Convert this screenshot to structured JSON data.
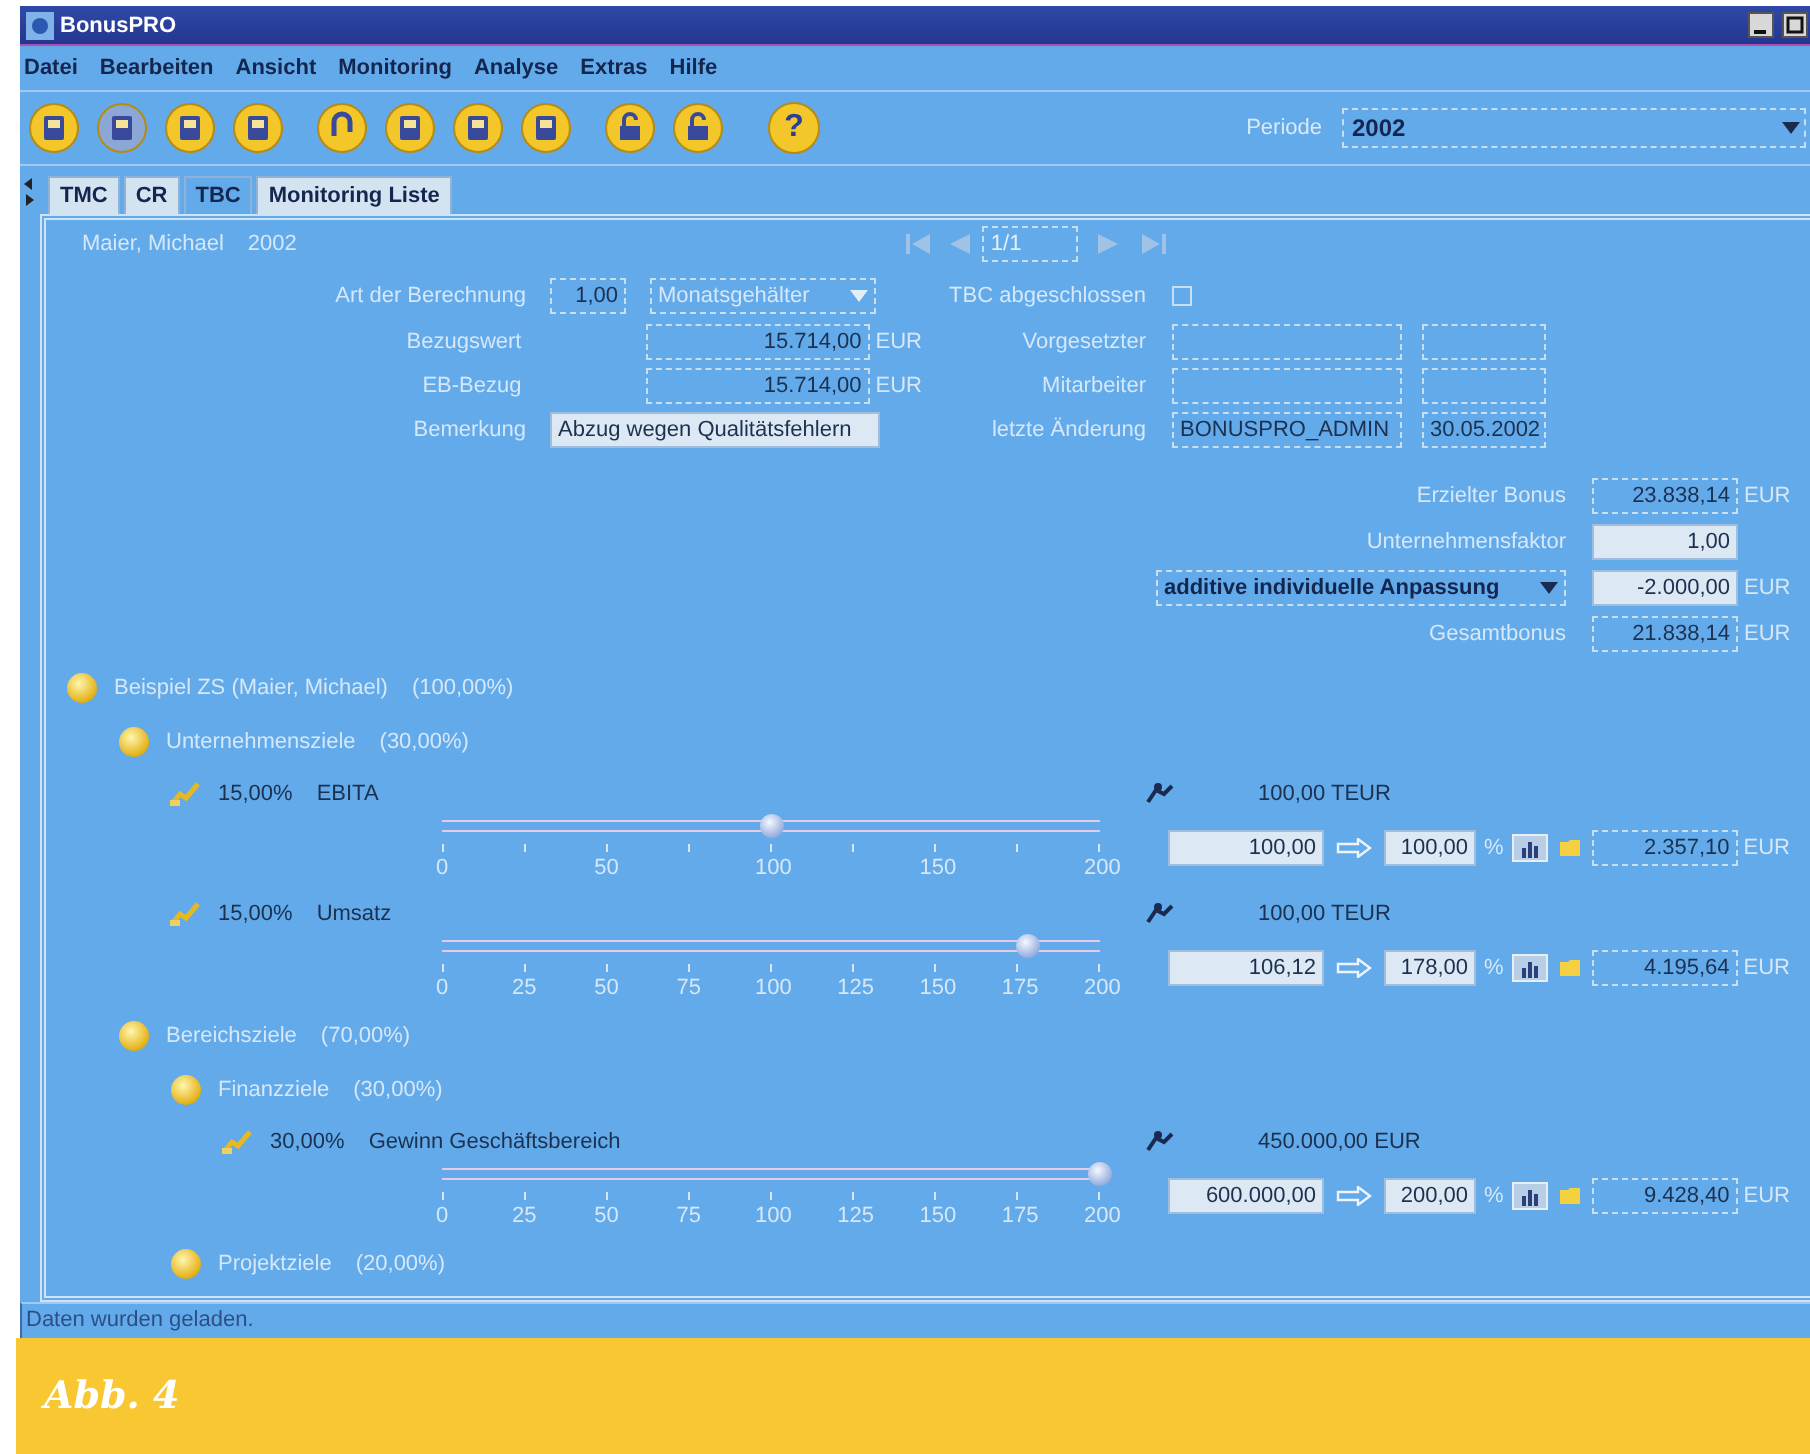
{
  "window": {
    "title": "BonusPRO"
  },
  "menu": [
    "Datei",
    "Bearbeiten",
    "Ansicht",
    "Monitoring",
    "Analyse",
    "Extras",
    "Hilfe"
  ],
  "toolbar": {
    "help_label": "?"
  },
  "period": {
    "label": "Periode",
    "value": "2002"
  },
  "tabs": [
    {
      "label": "TMC",
      "selected": false
    },
    {
      "label": "CR",
      "selected": false
    },
    {
      "label": "TBC",
      "selected": true
    },
    {
      "label": "Monitoring Liste",
      "selected": false
    }
  ],
  "header": {
    "name": "Maier, Michael",
    "year": "2002",
    "page": "1/1"
  },
  "form": {
    "calc": {
      "label": "Art der Berechnung",
      "factor": "1,00",
      "type": "Monatsgehälter"
    },
    "reference": {
      "label": "Bezugswert",
      "value": "15.714,00",
      "unit": "EUR"
    },
    "eb": {
      "label": "EB-Bezug",
      "value": "15.714,00",
      "unit": "EUR"
    },
    "remark": {
      "label": "Bemerkung",
      "value": "Abzug wegen Qualitätsfehlern"
    },
    "closed": {
      "label": "TBC abgeschlossen",
      "checked": false
    },
    "superior": {
      "label": "Vorgesetzter"
    },
    "employee": {
      "label": "Mitarbeiter"
    },
    "last_change": {
      "label": "letzte Änderung",
      "user": "BONUSPRO_ADMIN",
      "date": "30.05.2002"
    }
  },
  "bonus": {
    "achieved": {
      "label": "Erzielter Bonus",
      "value": "23.838,14",
      "unit": "EUR"
    },
    "factor": {
      "label": "Unternehmensfaktor",
      "value": "1,00"
    },
    "adjustment": {
      "type": "additive individuelle Anpassung",
      "value": "-2.000,00",
      "unit": "EUR"
    },
    "total": {
      "label": "Gesamtbonus",
      "value": "21.838,14",
      "unit": "EUR"
    }
  },
  "tree": [
    {
      "kind": "group",
      "label": "Beispiel ZS (Maier, Michael)",
      "share": "(100,00%)",
      "children": [
        {
          "kind": "group",
          "label": "Unternehmensziele",
          "share": "(30,00%)",
          "children": [
            {
              "kind": "goal",
              "weight": "15,00%",
              "name": "EBITA",
              "target": "100,00 TEUR",
              "level": 0.5,
              "ticks": [
                "0",
                "50",
                "100",
                "150",
                "200"
              ],
              "actual": "100,00",
              "percent": "100,00",
              "percent_unit": "%",
              "bonus": "2.357,10",
              "unit": "EUR"
            },
            {
              "kind": "goal",
              "weight": "15,00%",
              "name": "Umsatz",
              "target": "100,00 TEUR",
              "level": 0.89,
              "ticks": [
                "0",
                "25",
                "50",
                "75",
                "100",
                "125",
                "150",
                "175",
                "200"
              ],
              "actual": "106,12",
              "percent": "178,00",
              "percent_unit": "%",
              "bonus": "4.195,64",
              "unit": "EUR"
            }
          ]
        },
        {
          "kind": "group",
          "label": "Bereichsziele",
          "share": "(70,00%)",
          "children": [
            {
              "kind": "group",
              "label": "Finanzziele",
              "share": "(30,00%)",
              "children": [
                {
                  "kind": "goal",
                  "weight": "30,00%",
                  "name": "Gewinn Geschäftsbereich",
                  "target": "450.000,00 EUR",
                  "level": 1,
                  "ticks": [
                    "0",
                    "25",
                    "50",
                    "75",
                    "100",
                    "125",
                    "150",
                    "175",
                    "200"
                  ],
                  "actual": "600.000,00",
                  "percent": "200,00",
                  "percent_unit": "%",
                  "bonus": "9.428,40",
                  "unit": "EUR"
                }
              ]
            },
            {
              "kind": "group",
              "label": "Projektziele",
              "share": "(20,00%)"
            }
          ]
        }
      ]
    }
  ],
  "status_bar": "Daten wurden geladen.",
  "caption": "Abb. 4"
}
